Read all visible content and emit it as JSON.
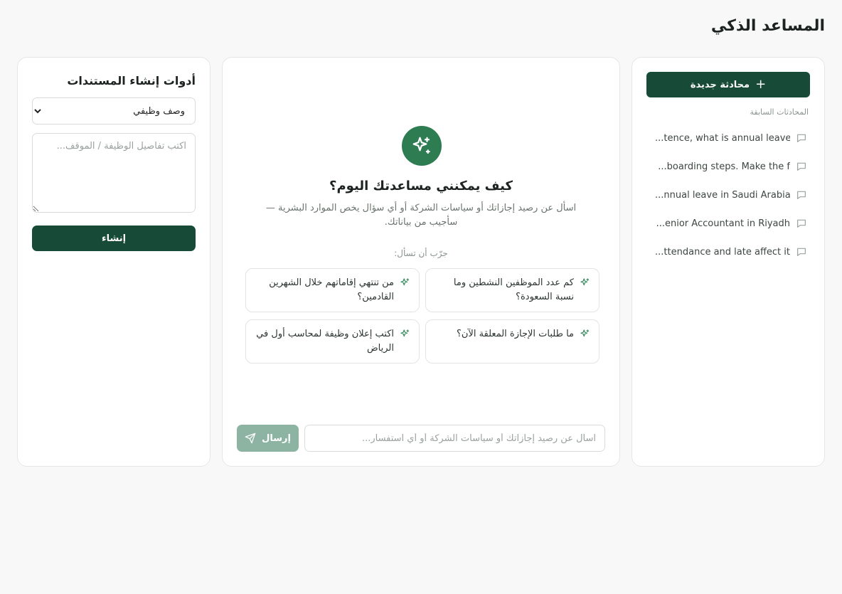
{
  "app": {
    "title": "المساعد الذكي"
  },
  "colors": {
    "primary": "#174a37",
    "accent": "#2d7c52",
    "send_disabled": "#8db3a2"
  },
  "sidebar": {
    "new_chat_label": "محادثة جديدة",
    "new_chat_icon": "plus-icon",
    "history_heading": "المحادثات السابقة",
    "history": [
      {
        "text": "...tence, what is annual leave",
        "icon": "message-icon"
      },
      {
        "text": "...boarding steps. Make the f",
        "icon": "message-icon"
      },
      {
        "text": "...nnual leave in Saudi Arabia",
        "icon": "message-icon"
      },
      {
        "text": "...enior Accountant in Riyadh",
        "icon": "message-icon"
      },
      {
        "text": "...ttendance and late affect it",
        "icon": "message-icon"
      }
    ]
  },
  "chat": {
    "hero_icon": "sparkles-icon",
    "hero_title": "كيف يمكنني مساعدتك اليوم؟",
    "hero_subtitle": "اسأل عن رصيد إجازاتك أو سياسات الشركة أو أي سؤال يخص الموارد البشرية — سأجيب من بياناتك.",
    "try_label": "جرّب أن تسأل:",
    "suggestions": [
      {
        "text": "كم عدد الموظفين النشطين وما نسبة السعودة؟",
        "icon": "sparkles-icon"
      },
      {
        "text": "من تنتهي إقاماتهم خلال الشهرين القادمين؟",
        "icon": "sparkles-icon"
      },
      {
        "text": "ما طلبات الإجازة المعلقة الآن؟",
        "icon": "sparkles-icon"
      },
      {
        "text": "اكتب إعلان وظيفة لمحاسب أول في الرياض",
        "icon": "sparkles-icon"
      }
    ],
    "input_placeholder": "اسأل عن رصيد إجازاتك أو سياسات الشركة أو أي استفسار...",
    "send_label": "إرسال",
    "send_icon": "send-icon"
  },
  "tools": {
    "title": "أدوات إنشاء المستندات",
    "selected_type": "وصف وظيفي",
    "details_placeholder": "اكتب تفاصيل الوظيفة / الموقف...",
    "create_label": "إنشاء"
  }
}
